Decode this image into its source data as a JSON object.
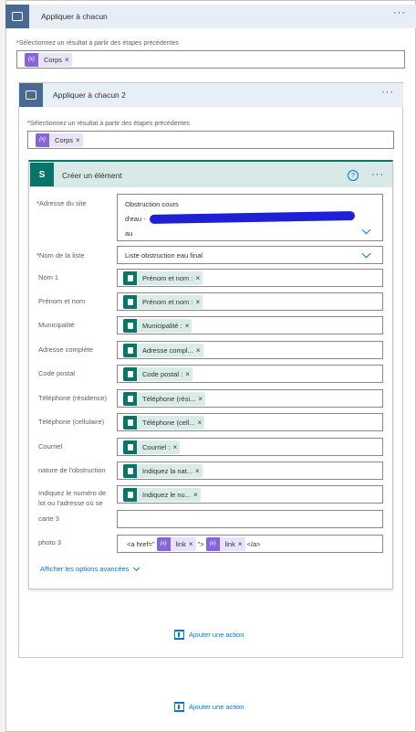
{
  "outer_loop": {
    "title": "Appliquer à chacun",
    "select_label": "Sélectionnez un résultat à partir des étapes précédentes",
    "token": "Corps"
  },
  "inner_loop": {
    "title": "Appliquer à chacun 2",
    "select_label": "Sélectionnez un résultat à partir des étapes précédentes",
    "token": "Corps"
  },
  "action": {
    "title": "Créer un élément",
    "help_icon": "?",
    "site_label": "Adresse du site",
    "site_value_line1": "Obstruction cours",
    "site_value_line2": "d'eau -",
    "site_value_line3": "au",
    "list_label": "Nom de la liste",
    "list_value": "Liste obstruction eau final",
    "fields": [
      {
        "label": "Nom 1",
        "token": "Prénom et nom :"
      },
      {
        "label": "Prénom et nom",
        "token": "Prénom et nom :"
      },
      {
        "label": "Municipalité",
        "token": "Municipalité :"
      },
      {
        "label": "Adresse complète",
        "token": "Adresse compl..."
      },
      {
        "label": "Code postal",
        "token": "Code postal :"
      },
      {
        "label": "Téléphone (résidence)",
        "token": "Téléphone (rési..."
      },
      {
        "label": "Téléphone (cellulaire)",
        "token": "Téléphone (cell..."
      },
      {
        "label": "Courriel",
        "token": "Courriel :"
      },
      {
        "label": "nature de l'obstruction",
        "token": "Indiquez la nat..."
      },
      {
        "label": "Indiquez le numéro de lot ou l'adresse où se",
        "token": "Indiquez le nu..."
      }
    ],
    "carte_label": "carte 3",
    "photo_label": "photo 3",
    "code_open": "<a href=\"",
    "code_mid": "\">",
    "code_close": "</a>",
    "link_token": "link",
    "advanced": "Afficher les options avancées"
  },
  "add_action": "Ajouter une action",
  "colors": {
    "loop": "#486991",
    "sharepoint": "#077568",
    "expression": "#8764d8",
    "link": "#0078d4"
  }
}
